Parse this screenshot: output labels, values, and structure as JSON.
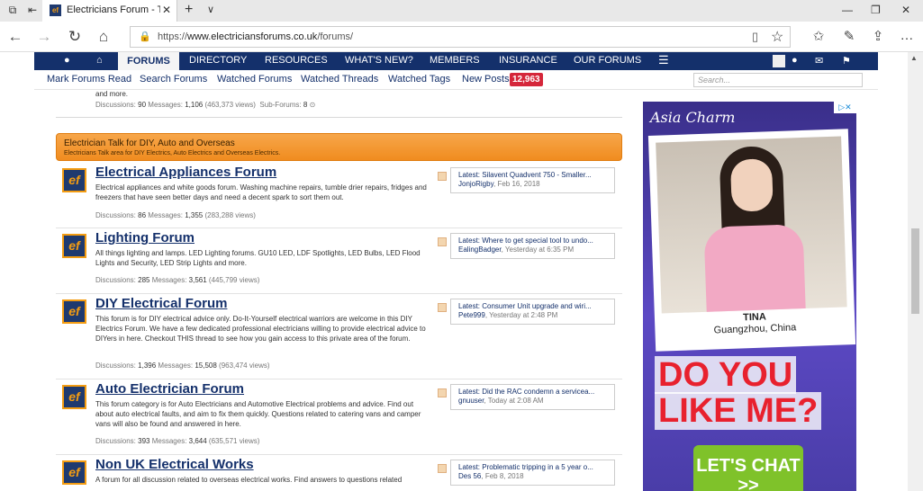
{
  "browser": {
    "tab_title": "Electricians Forum - Talk",
    "tab_favicon": "ef",
    "url_prefix": "https://",
    "url_domain": "www.electriciansforums.co.uk",
    "url_path": "/forums/",
    "icons": [
      "tab-set-aside-icon",
      "tab-back-icon",
      "close-icon",
      "new-tab-icon",
      "chevron-down-icon",
      "minimize-icon",
      "restore-icon",
      "close-window-icon",
      "back-icon",
      "forward-icon",
      "refresh-icon",
      "home-icon",
      "lock-icon",
      "reading-view-icon",
      "favorite-star-icon",
      "favorites-icon",
      "pen-icon",
      "share-icon",
      "more-icon"
    ]
  },
  "site_nav": {
    "items": [
      "FORUMS",
      "DIRECTORY",
      "RESOURCES",
      "WHAT'S NEW?",
      "MEMBERS",
      "INSURANCE",
      "OUR FORUMS"
    ],
    "active": "FORUMS"
  },
  "sub_nav": {
    "items": [
      "Mark Forums Read",
      "Search Forums",
      "Watched Forums",
      "Watched Threads",
      "Watched Tags",
      "New Posts"
    ],
    "new_posts_count": "12,963",
    "search_placeholder": "Search..."
  },
  "previous_forum": {
    "tail": "and more.",
    "discussions": "90",
    "messages": "1,106",
    "views": "(463,373 views)",
    "subforums": "8"
  },
  "labels": {
    "discussions": "Discussions:",
    "messages": "Messages:",
    "subforums": "Sub-Forums:",
    "latest": "Latest:"
  },
  "category": {
    "title": "Electrician Talk for DIY, Auto and Overseas",
    "description": "Electricians Talk area for DIY Electrics, Auto Electrics and Overseas Electrics."
  },
  "forums": [
    {
      "name": "Electrical Appliances Forum",
      "description": "Electrical appliances and white goods forum. Washing machine repairs, tumble drier repairs, fridges and freezers that have seen better days and need a decent spark to sort them out.",
      "discussions": "86",
      "messages": "1,355",
      "views": "(283,288 views)",
      "latest_title": "Silavent Quadvent 750 - Smaller...",
      "latest_user": "JonjoRigby",
      "latest_time": "Feb 16, 2018"
    },
    {
      "name": "Lighting Forum",
      "description": "All things lighting and lamps. LED Lighting forums. GU10 LED, LDF Spotlights, LED Bulbs, LED Flood Lights and Security, LED Strip Lights and more.",
      "discussions": "285",
      "messages": "3,561",
      "views": "(445,799 views)",
      "latest_title": "Where to get special tool to undo...",
      "latest_user": "EalingBadger",
      "latest_time": "Yesterday at 6:35 PM"
    },
    {
      "name": "DIY Electrical Forum",
      "description": "This forum is for DIY electrical advice only. Do-It-Yourself electrical warriors are welcome in this DIY Electrics Forum. We have a few dedicated professional electricians willing to provide electrical advice to DIYers in here. Checkout THIS thread to see how you gain access to this private area of the forum.",
      "discussions": "1,396",
      "messages": "15,508",
      "views": "(963,474 views)",
      "latest_title": "Consumer Unit upgrade and wiri...",
      "latest_user": "Pete999",
      "latest_time": "Yesterday at 2:48 PM"
    },
    {
      "name": "Auto Electrician Forum",
      "description": "This forum category is for Auto Electricians and Automotive Electrical problems and advice. Find out about auto electrical faults, and aim to fix them quickly. Questions related to catering vans and camper vans will also be found and answered in here.",
      "discussions": "393",
      "messages": "3,644",
      "views": "(635,571 views)",
      "latest_title": "Did the RAC condemn a servicea...",
      "latest_user": "gnuuser",
      "latest_time": "Today at 2:08 AM"
    },
    {
      "name": "Non UK Electrical Works",
      "description": "A forum for all discussion related to overseas electrical works. Find answers to questions related",
      "discussions": "",
      "messages": "",
      "views": "",
      "latest_title": "Problematic tripping in a 5 year o...",
      "latest_user": "Des 56",
      "latest_time": "Feb 8, 2018"
    }
  ],
  "ad": {
    "brand": "Asia Charm",
    "name": "TINA",
    "city": "Guangzhou, China",
    "line1": "DO YOU",
    "line2": "LIKE ME?",
    "button": "LET'S CHAT >>"
  }
}
